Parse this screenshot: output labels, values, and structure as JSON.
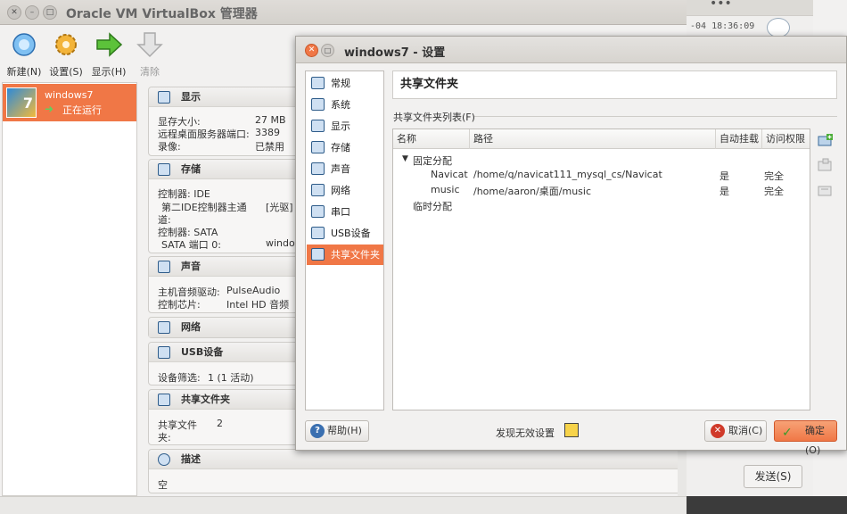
{
  "background_window": {
    "timestamp": "-04 18:36:09",
    "send_button": "发送(S)",
    "top_dots": "•••"
  },
  "main_window": {
    "title": "Oracle VM VirtualBox 管理器",
    "toolbar": {
      "new": "新建(N)",
      "settings": "设置(S)",
      "start": "显示(H)",
      "discard": "清除"
    },
    "vm": {
      "name": "windows7",
      "status": "正在运行",
      "logo_text": "7"
    },
    "sections": {
      "display": {
        "title": "显示",
        "rows": [
          {
            "label": "显存大小:",
            "value": "27 MB"
          },
          {
            "label": "远程桌面服务器端口:",
            "value": "3389"
          },
          {
            "label": "录像:",
            "value": "已禁用"
          }
        ]
      },
      "storage": {
        "title": "存储",
        "line1": "控制器: IDE",
        "line2a": "第二IDE控制器主通",
        "line2b": "道:",
        "line2v": "[光驱] V",
        "line3": "控制器: SATA",
        "line4": "SATA 端口 0:",
        "line4v": "window"
      },
      "audio": {
        "title": "声音",
        "rows": [
          {
            "label": "主机音频驱动:",
            "value": "PulseAudio"
          },
          {
            "label": "控制芯片:",
            "value": "Intel HD 音频"
          }
        ]
      },
      "network": {
        "title": "网络"
      },
      "usb": {
        "title": "USB设备",
        "line": "设备筛选:",
        "value": "1 (1 活动)"
      },
      "shared": {
        "title": "共享文件夹",
        "label1": "共享文件",
        "label2": "夹:",
        "value": "2"
      },
      "description": {
        "title": "描述",
        "value": "空"
      }
    }
  },
  "dialog": {
    "title": "windows7 - 设置",
    "nav": [
      "常规",
      "系统",
      "显示",
      "存储",
      "声音",
      "网络",
      "串口",
      "USB设备",
      "共享文件夹"
    ],
    "selected_nav": "共享文件夹",
    "page_title": "共享文件夹",
    "list_label": "共享文件夹列表(F)",
    "columns": [
      "名称",
      "路径",
      "自动挂载",
      "访问权限"
    ],
    "groups": {
      "fixed": "固定分配",
      "temporary": "临时分配"
    },
    "folders": [
      {
        "name": "Navicat",
        "path": "/home/q/navicat111_mysql_cs/Navicat",
        "auto_mount": "是",
        "access": "完全"
      },
      {
        "name": "music",
        "path": "/home/aaron/桌面/music",
        "auto_mount": "是",
        "access": "完全"
      }
    ],
    "help_button": "帮助(H)",
    "warning_text": "发现无效设置",
    "cancel_button": "取消(C)",
    "ok_button": "确定(O)"
  }
}
